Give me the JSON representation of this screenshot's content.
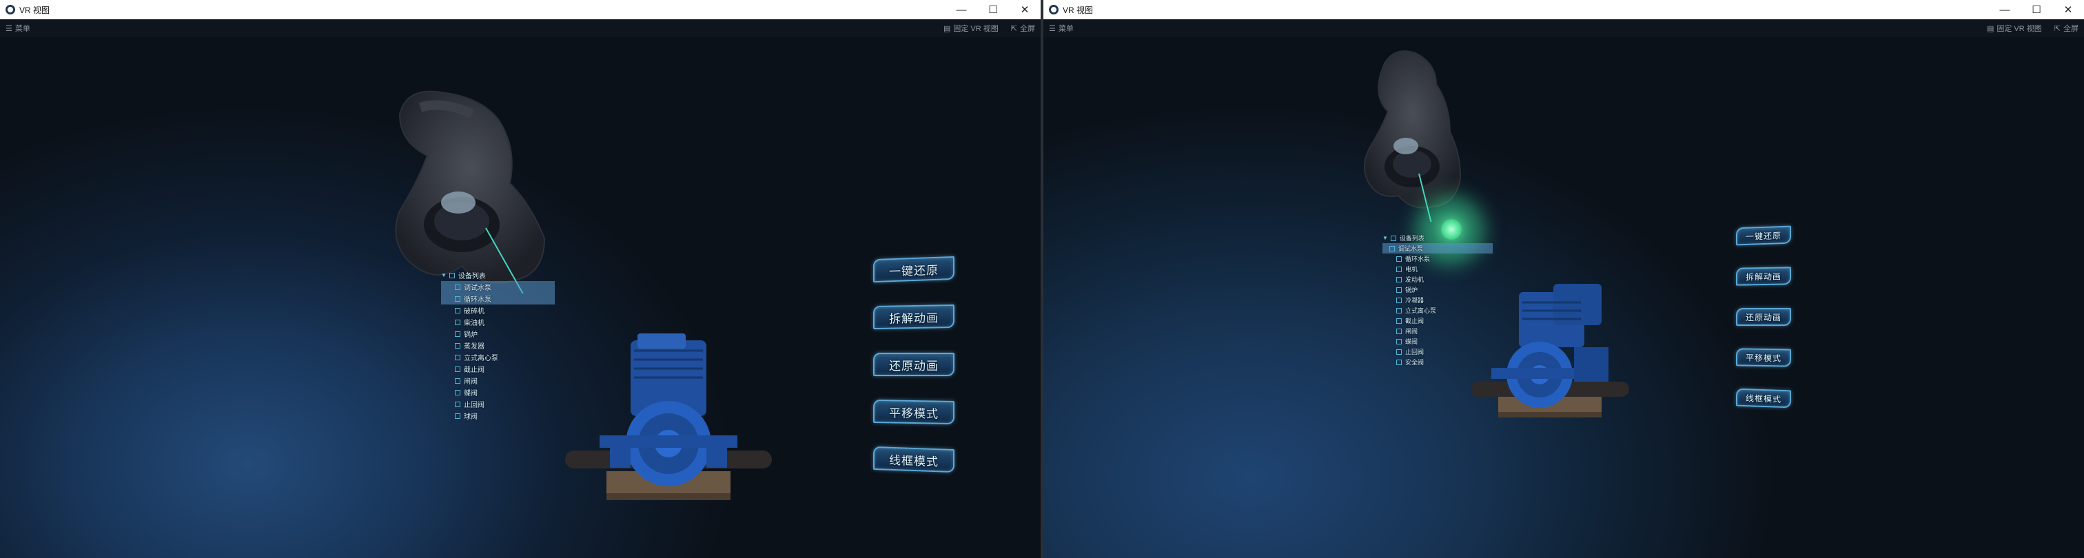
{
  "windows": [
    {
      "title": "VR 视图",
      "menu_label": "菜单",
      "pin_label": "固定 VR 视图",
      "fullscreen_label": "全屏",
      "tree": {
        "root": "设备列表",
        "items": [
          "调试水泵",
          "循环水泵",
          "破碎机",
          "柴油机",
          "锅炉",
          "蒸发器",
          "立式离心泵",
          "截止阀",
          "闸阀",
          "蝶阀",
          "止回阀",
          "球阀"
        ]
      },
      "buttons": [
        "一键还原",
        "拆解动画",
        "还原动画",
        "平移模式",
        "线框模式"
      ]
    },
    {
      "title": "VR 视图",
      "menu_label": "菜单",
      "pin_label": "固定 VR 视图",
      "fullscreen_label": "全屏",
      "tree": {
        "root": "设备列表",
        "items": [
          "调试水泵",
          "循环水泵",
          "电机",
          "发动机",
          "锅炉",
          "冷凝器",
          "立式离心泵",
          "截止阀",
          "闸阀",
          "蝶阀",
          "止回阀",
          "安全阀"
        ]
      },
      "buttons": [
        "一键还原",
        "拆解动画",
        "还原动画",
        "平移模式",
        "线框模式"
      ]
    }
  ],
  "colors": {
    "accent": "#5aa9d6",
    "glow": "#7ff0b4",
    "pump": "#1f4f9e",
    "pipe": "#2e2a2a"
  }
}
